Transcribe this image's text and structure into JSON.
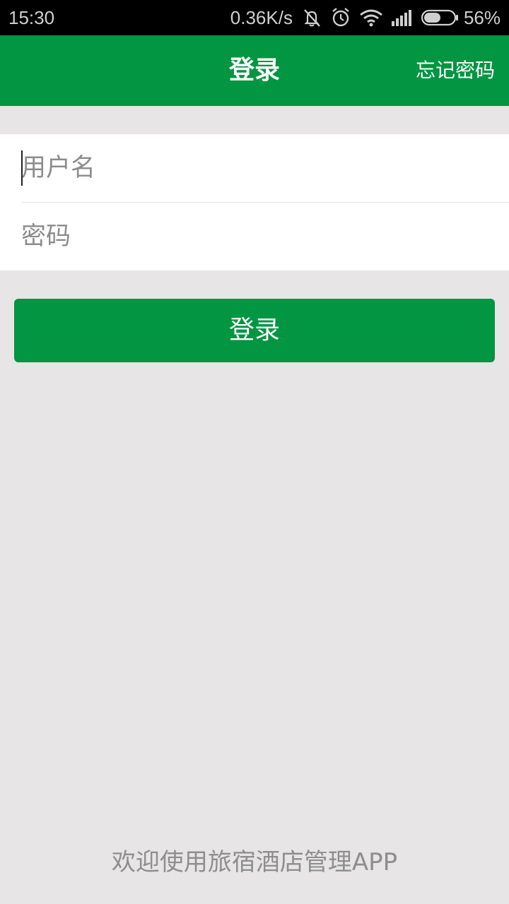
{
  "status_bar": {
    "time": "15:30",
    "network_speed": "0.36K/s",
    "icons": [
      "mute-icon",
      "alarm-icon",
      "wifi-icon",
      "signal-icon",
      "battery-icon"
    ],
    "battery_percent": "56%",
    "battery_level": 0.56
  },
  "header": {
    "title": "登录",
    "forgot_password_label": "忘记密码"
  },
  "form": {
    "username_placeholder": "用户名",
    "username_value": "",
    "password_placeholder": "密码",
    "password_value": ""
  },
  "login_button": {
    "label": "登录"
  },
  "footer": {
    "welcome_text": "欢迎使用旅宿酒店管理APP"
  },
  "colors": {
    "primary_green": "#029542",
    "background": "#e7e5e6",
    "status_bar": "#000000",
    "placeholder_text": "#8c8c8c",
    "footer_text": "#8e8e8e"
  }
}
